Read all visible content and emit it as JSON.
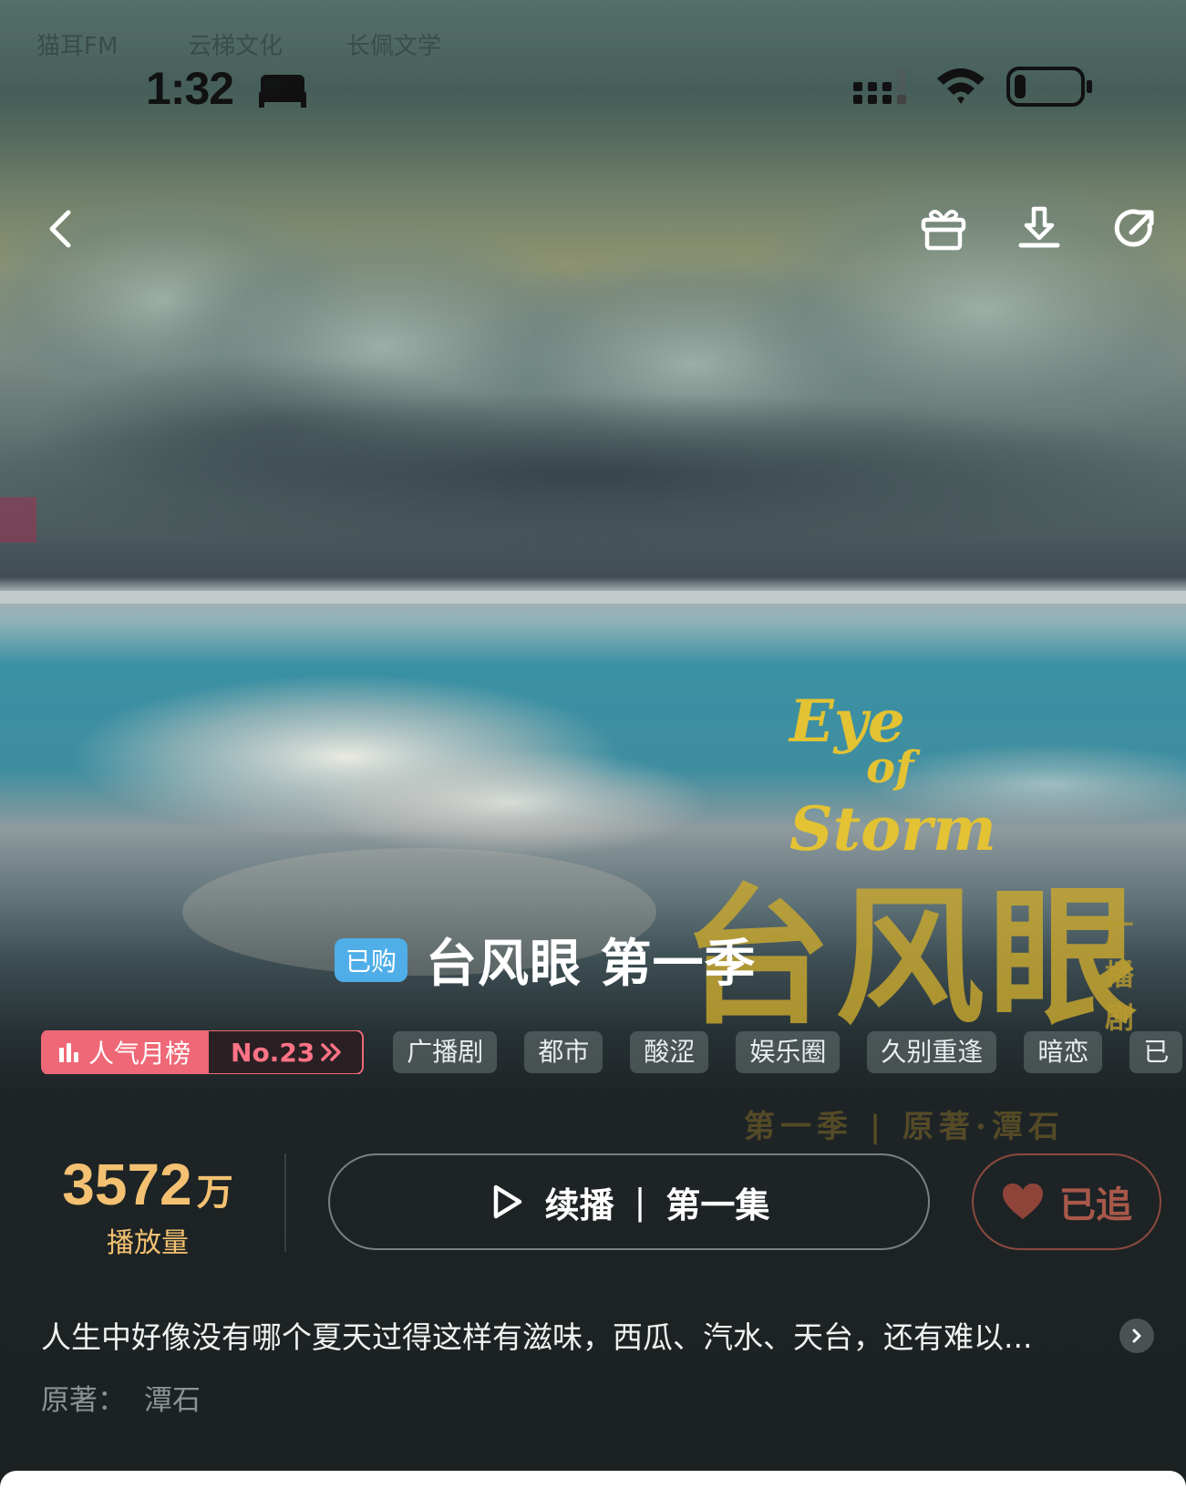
{
  "status_bar": {
    "time": "1:32",
    "watermarks": [
      "猫耳FM",
      "云梯文化",
      "长佩文学"
    ]
  },
  "top_nav": {
    "icons": [
      "back-icon",
      "gift-icon",
      "download-icon",
      "share-icon"
    ]
  },
  "cover": {
    "english_title_line1": "Eye",
    "english_title_line2": "of",
    "english_title_line3": "Storm",
    "chinese_title": "台风眼",
    "side_text": "广播剧",
    "subtitle": "第一季 | 原著·潭石",
    "text_color": "#e3c233"
  },
  "title": {
    "badge": "已购",
    "name": "台风眼 第一季"
  },
  "ranking": {
    "label": "人气月榜",
    "rank": "No.23",
    "color": "#ef6877"
  },
  "tags": [
    "广播剧",
    "都市",
    "酸涩",
    "娱乐圈",
    "久别重逢",
    "暗恋",
    "已"
  ],
  "stats": {
    "play_count": "3572",
    "play_unit": "万",
    "play_label": "播放量",
    "accent": "#f3c171"
  },
  "actions": {
    "resume_label": "续播",
    "separator": "|",
    "episode_label": "第一集",
    "follow_label": "已追"
  },
  "description": {
    "text": "人生中好像没有哪个夏天过得这样有滋味，西瓜、汽水、天台，还有难以...",
    "author_label": "原著：",
    "author_name": "潭石"
  }
}
